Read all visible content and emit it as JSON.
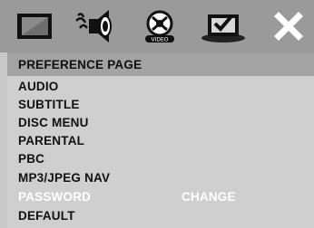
{
  "tabs": [
    {
      "icon": "screen-icon"
    },
    {
      "icon": "speaker-audio-icon"
    },
    {
      "icon": "disc-icon"
    },
    {
      "icon": "preference-icon",
      "selected": true
    },
    {
      "icon": "close-icon"
    }
  ],
  "header": {
    "title": "PREFERENCE PAGE"
  },
  "menu": {
    "items": [
      {
        "label": "AUDIO"
      },
      {
        "label": "SUBTITLE"
      },
      {
        "label": "DISC MENU"
      },
      {
        "label": "PARENTAL"
      },
      {
        "label": "PBC"
      },
      {
        "label": "MP3/JPEG NAV"
      },
      {
        "label": "PASSWORD",
        "highlighted": true
      },
      {
        "label": "DEFAULT"
      }
    ],
    "password_value": "CHANGE"
  },
  "colors": {
    "topbar": "#9a9a9a",
    "header": "#a3a3a3",
    "panel": "#cfcfcf",
    "highlight_text": "#ffffff"
  }
}
